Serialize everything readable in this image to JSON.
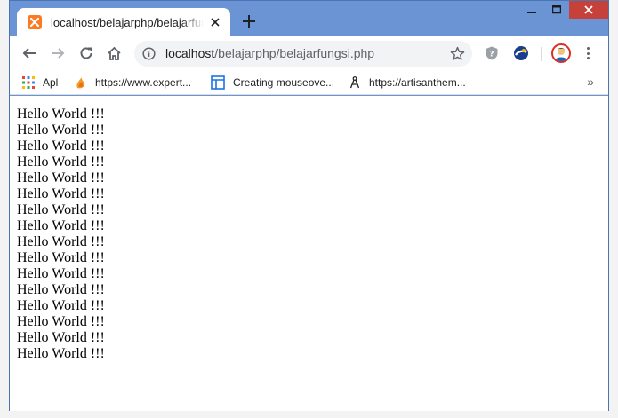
{
  "browser": {
    "tab": {
      "title": "localhost/belajarphp/belajarfungsi.php"
    },
    "url": {
      "host": "localhost",
      "path": "/belajarphp/belajarfungsi.php"
    }
  },
  "bookmarks": [
    {
      "label": "Apl",
      "icon": "apps-grid-icon"
    },
    {
      "label": "https://www.expert...",
      "icon": "flame-icon"
    },
    {
      "label": "Creating mouseove...",
      "icon": "layout-icon"
    },
    {
      "label": "https://artisanthem...",
      "icon": "compass-icon"
    }
  ],
  "bookmarks_more": "»",
  "page": {
    "lines": [
      "Hello World !!!",
      "Hello World !!!",
      "Hello World !!!",
      "Hello World !!!",
      "Hello World !!!",
      "Hello World !!!",
      "Hello World !!!",
      "Hello World !!!",
      "Hello World !!!",
      "Hello World !!!",
      "Hello World !!!",
      "Hello World !!!",
      "Hello World !!!",
      "Hello World !!!",
      "Hello World !!!",
      "Hello World !!!"
    ]
  },
  "colors": {
    "accent": "#6a94d4",
    "close": "#c7413b",
    "favicon": "#fb7a24"
  }
}
